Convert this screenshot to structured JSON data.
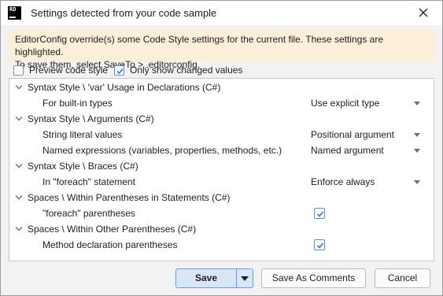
{
  "window": {
    "title": "Settings detected from your code sample",
    "app_icon_text": "RD"
  },
  "banner": {
    "line1": "EditorConfig override(s) some Code Style settings for the current file. These settings are highlighted.",
    "line2": "To save them, select SaveTo > .editorconfig."
  },
  "options": {
    "preview": {
      "label": "Preview code style",
      "checked": false
    },
    "only_changed": {
      "label": "Only show changed values",
      "checked": true
    }
  },
  "tree": {
    "groups": [
      {
        "label": "Syntax Style \\ 'var' Usage in Declarations (C#)",
        "items": [
          {
            "label": "For built-in types",
            "value": "Use explicit type"
          }
        ]
      },
      {
        "label": "Syntax Style \\ Arguments (C#)",
        "items": [
          {
            "label": "String literal values",
            "value": "Positional argument"
          },
          {
            "label": "Named expressions (variables, properties, methods, etc.)",
            "value": "Named argument"
          }
        ]
      },
      {
        "label": "Syntax Style \\ Braces (C#)",
        "items": [
          {
            "label": "In \"foreach\" statement",
            "value": "Enforce always"
          }
        ]
      },
      {
        "label": "Spaces \\ Within Parentheses in Statements (C#)",
        "items": [
          {
            "label": "\"foreach\" parentheses",
            "checked": true
          }
        ]
      },
      {
        "label": "Spaces \\ Within Other Parentheses (C#)",
        "items": [
          {
            "label": "Method declaration parentheses",
            "checked": true
          }
        ]
      }
    ]
  },
  "buttons": {
    "save": "Save",
    "save_as_comments": "Save As Comments",
    "cancel": "Cancel"
  },
  "colors": {
    "banner_bg": "#fbefd8",
    "accent": "#5b8fd6"
  }
}
